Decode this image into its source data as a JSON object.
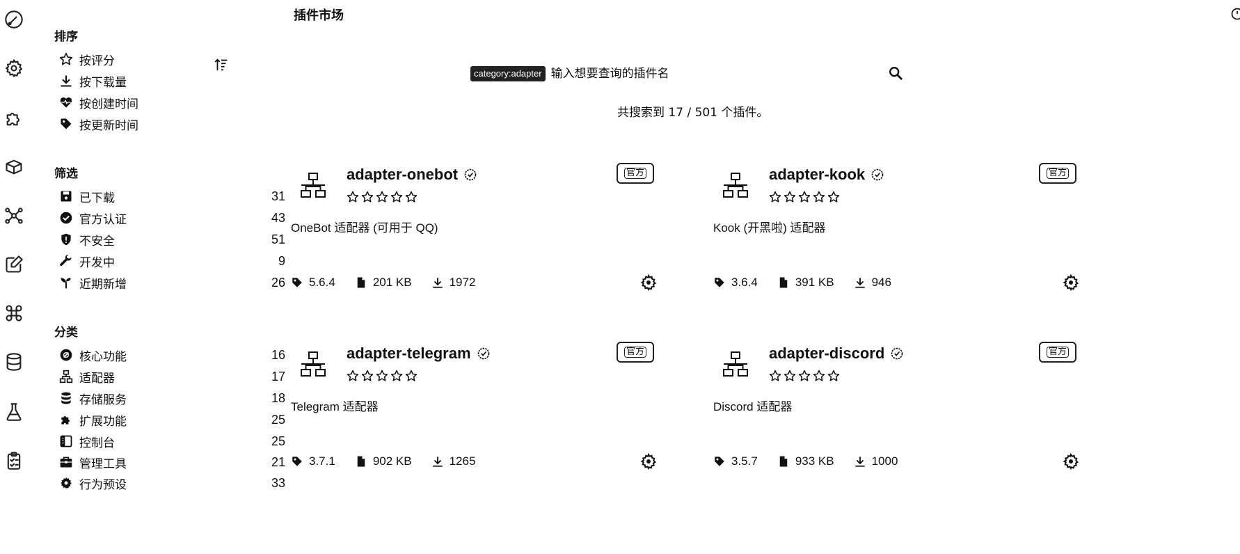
{
  "activity_bar": [
    {
      "icon": "dashboard-icon"
    },
    {
      "icon": "gear-icon"
    },
    {
      "icon": "puzzle-icon"
    },
    {
      "icon": "box-icon"
    },
    {
      "icon": "network-icon"
    },
    {
      "icon": "edit-icon"
    },
    {
      "icon": "command-icon"
    },
    {
      "icon": "database-icon"
    },
    {
      "icon": "flask-icon"
    },
    {
      "icon": "clipboard-icon"
    }
  ],
  "sidebar": {
    "sort_title": "排序",
    "sort_items": [
      {
        "label": "按评分",
        "icon": "star-icon"
      },
      {
        "label": "按下载量",
        "icon": "download-icon"
      },
      {
        "label": "按创建时间",
        "icon": "heart-pulse-icon"
      },
      {
        "label": "按更新时间",
        "icon": "tag-icon"
      }
    ],
    "filter_title": "筛选",
    "filter_items": [
      {
        "label": "已下载",
        "count": "31",
        "icon": "save-icon"
      },
      {
        "label": "官方认证",
        "count": "43",
        "icon": "verified-icon"
      },
      {
        "label": "不安全",
        "count": "51",
        "icon": "shield-icon"
      },
      {
        "label": "开发中",
        "count": "9",
        "icon": "wrench-icon"
      },
      {
        "label": "近期新增",
        "count": "26",
        "icon": "seedling-icon"
      }
    ],
    "category_title": "分类",
    "category_items": [
      {
        "label": "核心功能",
        "count": "16",
        "icon": "core-icon"
      },
      {
        "label": "适配器",
        "count": "17",
        "icon": "sitemap-icon"
      },
      {
        "label": "存储服务",
        "count": "18",
        "icon": "database-icon"
      },
      {
        "label": "扩展功能",
        "count": "25",
        "icon": "puzzle-icon"
      },
      {
        "label": "控制台",
        "count": "25",
        "icon": "console-icon"
      },
      {
        "label": "管理工具",
        "count": "21",
        "icon": "toolbox-icon"
      },
      {
        "label": "行为预设",
        "count": "33",
        "icon": "cog-icon"
      }
    ]
  },
  "main": {
    "title": "插件市场",
    "search": {
      "tag": "category:adapter",
      "placeholder": "输入想要查询的插件名"
    },
    "result_count": "共搜索到 17 / 501 个插件。",
    "plugins": [
      {
        "name": "adapter-onebot",
        "desc": "OneBot 适配器 (可用于 QQ)",
        "version": "5.6.4",
        "size": "201 KB",
        "downloads": "1972",
        "rating": 0,
        "badge": "官方"
      },
      {
        "name": "adapter-kook",
        "desc": "Kook (开黑啦) 适配器",
        "version": "3.6.4",
        "size": "391 KB",
        "downloads": "946",
        "rating": 0,
        "badge": "官方"
      },
      {
        "name": "adapter-telegram",
        "desc": "Telegram 适配器",
        "version": "3.7.1",
        "size": "902 KB",
        "downloads": "1265",
        "rating": 0,
        "badge": "官方"
      },
      {
        "name": "adapter-discord",
        "desc": "Discord 适配器",
        "version": "3.5.7",
        "size": "933 KB",
        "downloads": "1000",
        "rating": 0,
        "badge": "官方"
      }
    ]
  }
}
